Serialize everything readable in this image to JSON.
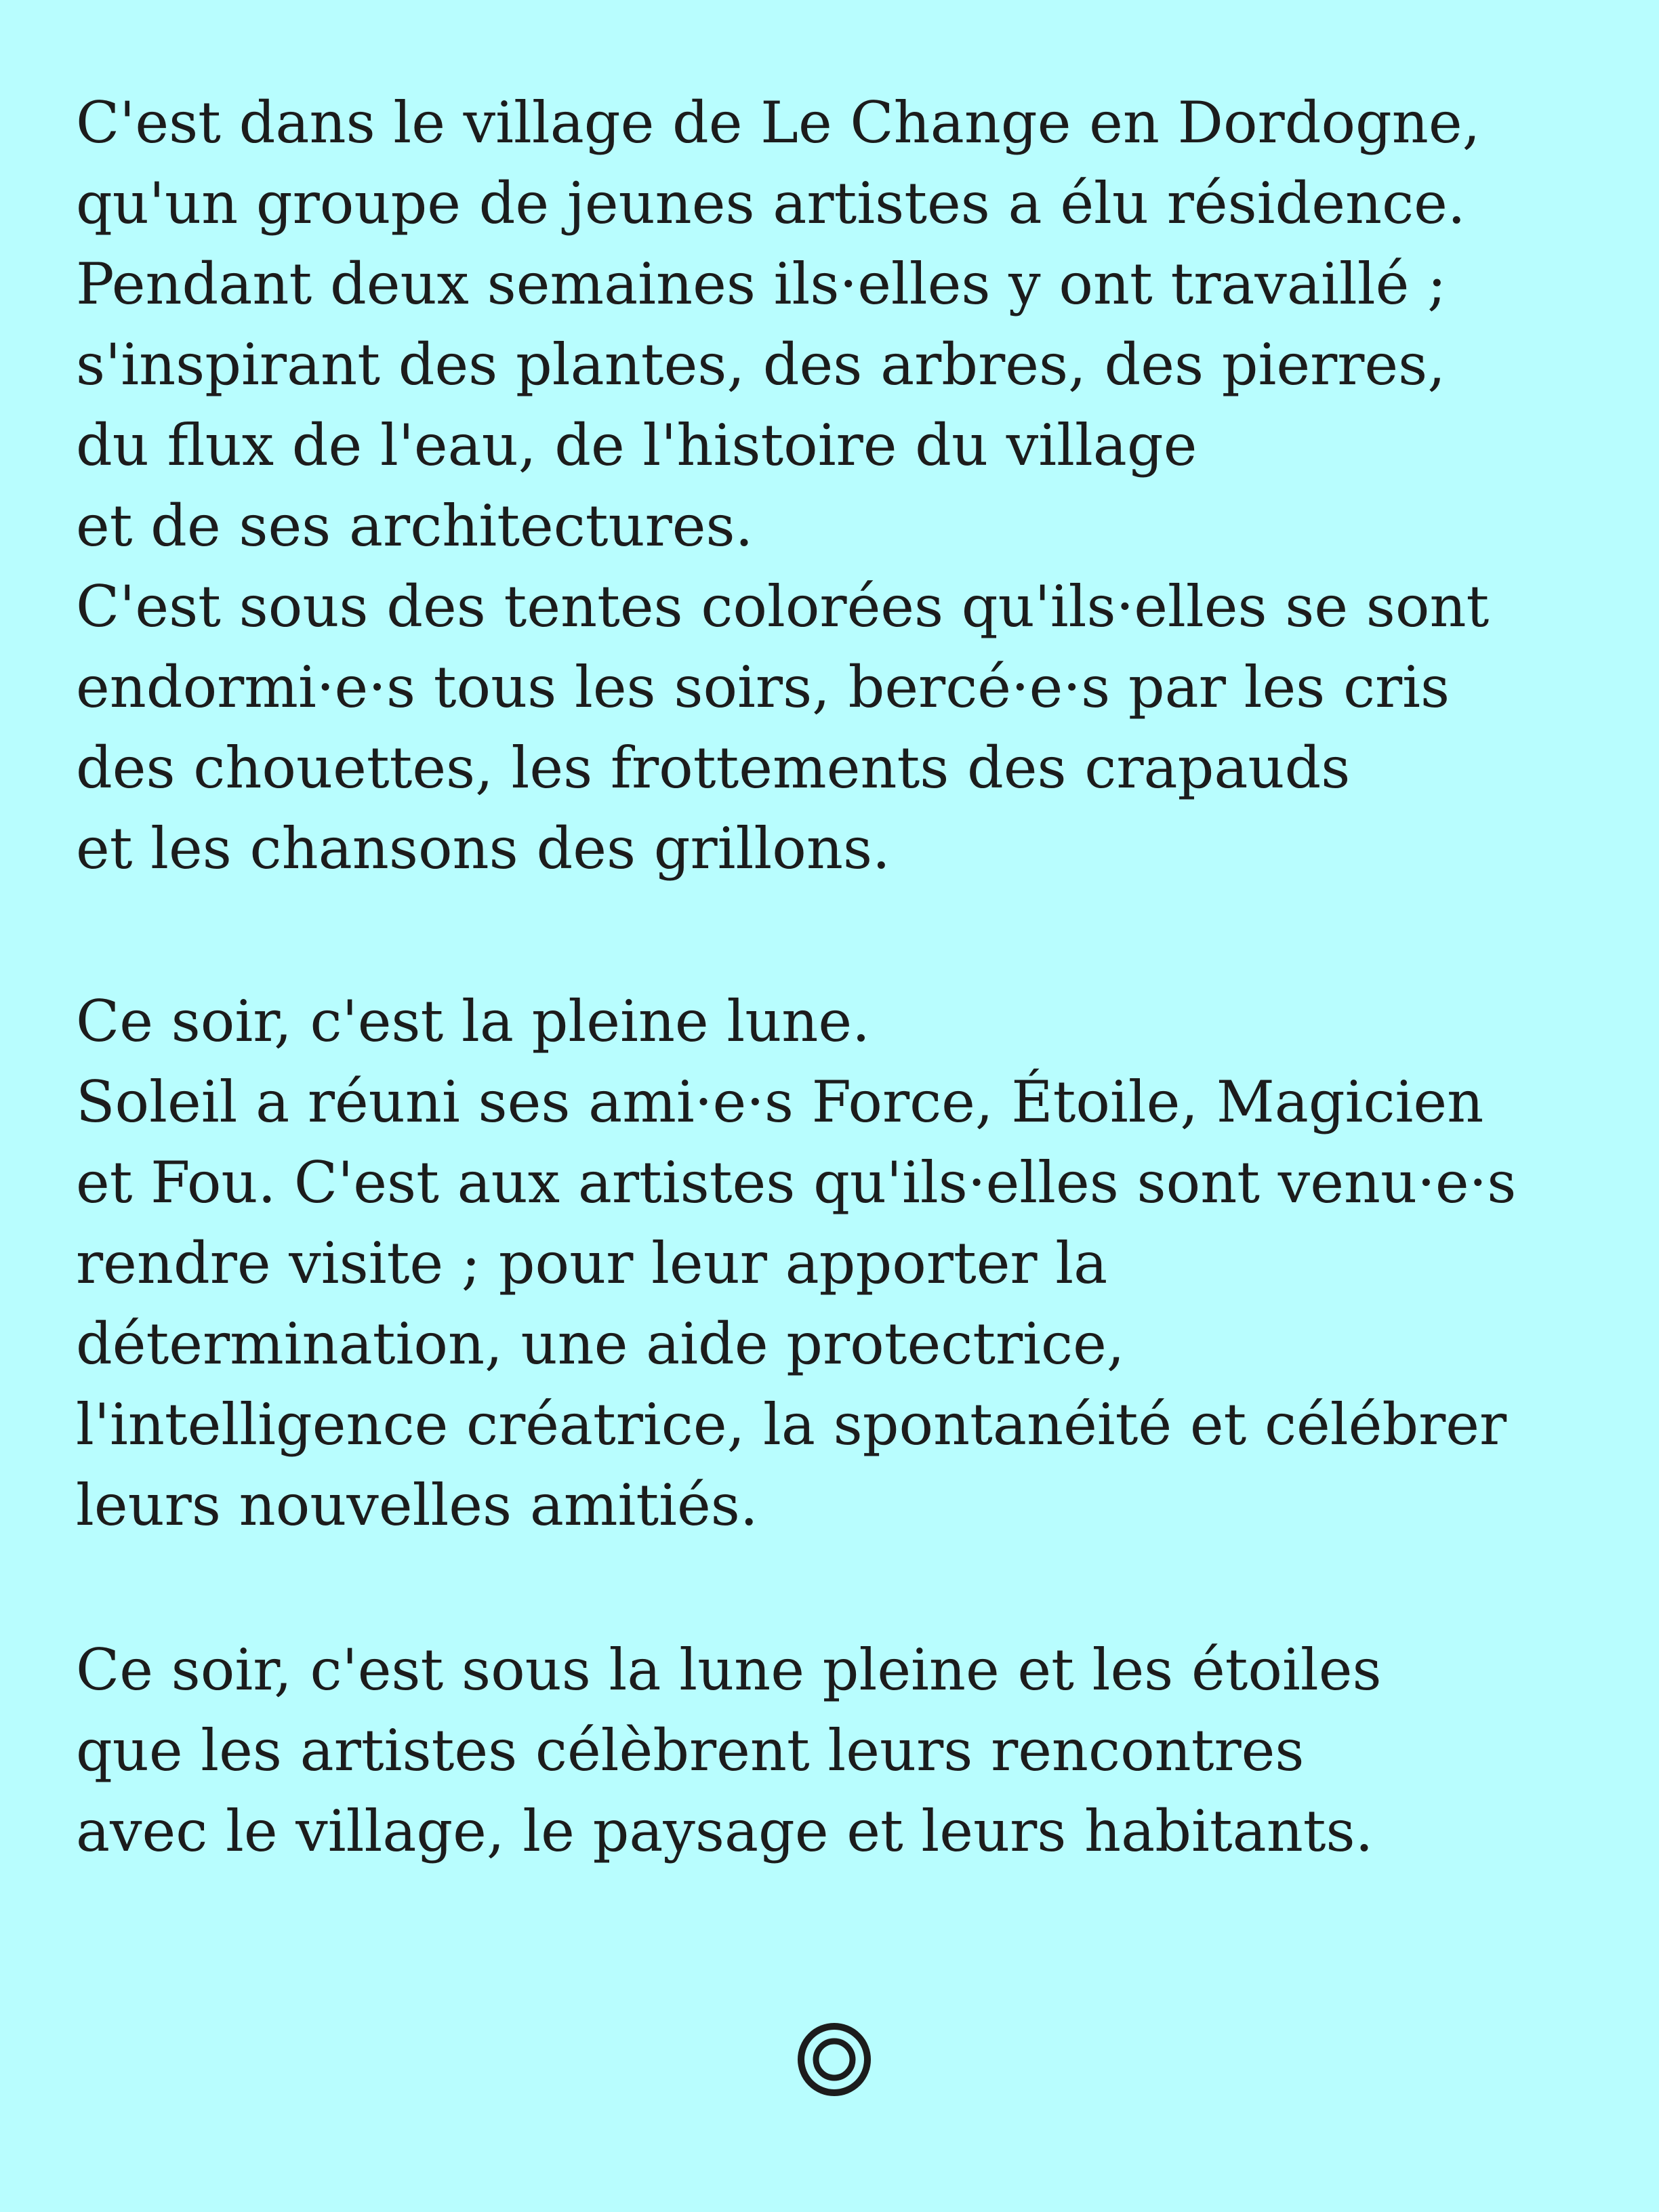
{
  "paragraphs": [
    {
      "lines": [
        "C'est dans le village de Le Change en Dordogne,",
        "qu'un groupe de jeunes artistes a élu résidence.",
        "Pendant deux semaines ils·elles y ont travaillé ;",
        "s'inspirant des plantes, des arbres, des pierres,",
        "du flux de l'eau, de l'histoire du village",
        "et de ses architectures.",
        "C'est sous des tentes colorées qu'ils·elles se sont",
        "endormi·e·s tous les soirs, bercé·e·s par les cris",
        "des chouettes, les frottements des crapauds",
        "et les chansons des grillons."
      ]
    },
    {
      "lines": [
        "Ce soir, c'est la pleine lune.",
        "Soleil a réuni ses ami·e·s Force, Étoile, Magicien",
        "et Fou. C'est aux artistes qu'ils·elles sont venu·e·s",
        "rendre visite ; pour leur apporter la",
        "détermination, une aide protectrice,",
        "l'intelligence créatrice, la spontanéité et célébrer",
        "leurs nouvelles amitiés."
      ]
    },
    {
      "lines": [
        "Ce soir, c'est sous la lune pleine et les étoiles",
        "que les artistes célèbrent leurs rencontres",
        "avec le village, le paysage et leurs habitants."
      ]
    }
  ],
  "ornament": {
    "icon": "double-circle-icon",
    "color": "#1c1c1c"
  },
  "colors": {
    "background": "#b8fdfe",
    "text": "#1c1c1c"
  }
}
